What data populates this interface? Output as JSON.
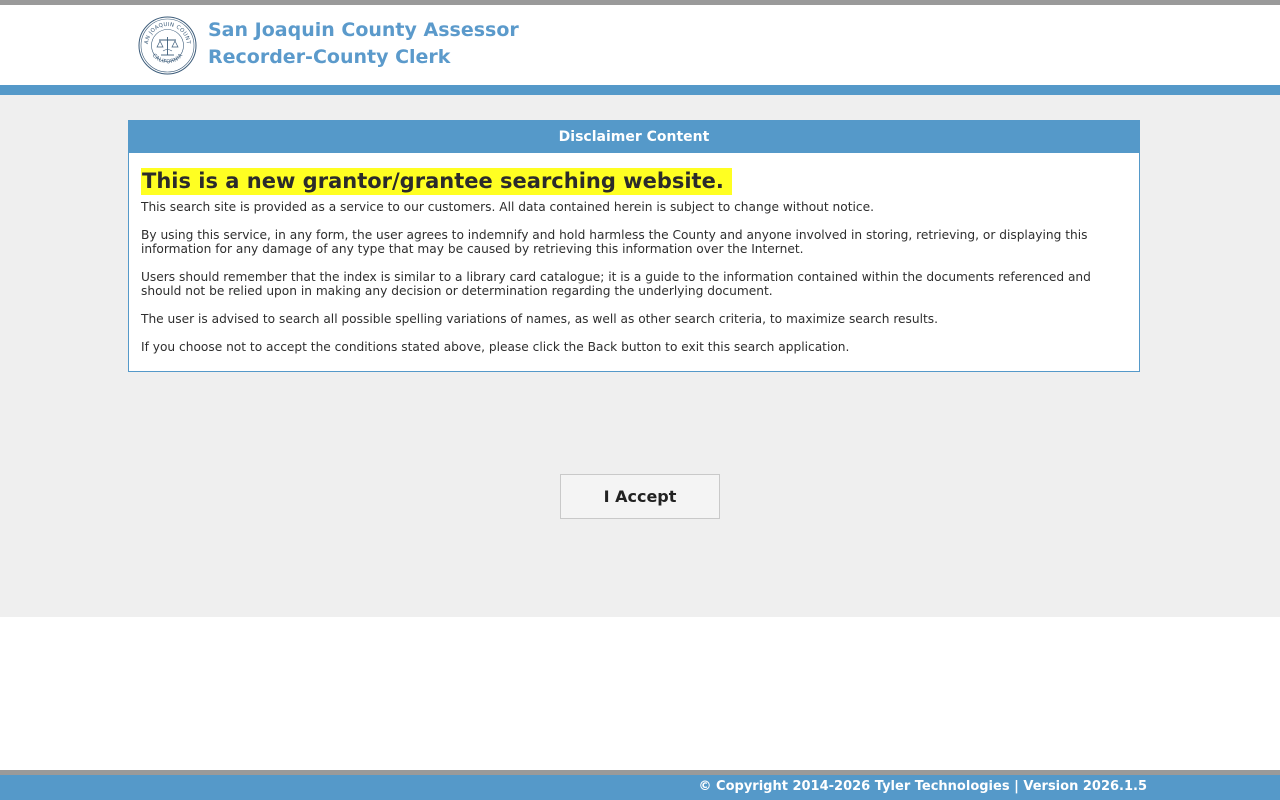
{
  "header": {
    "title": "San Joaquin County Assessor Recorder-County Clerk",
    "seal": {
      "top_text": "SAN JOAQUIN COUNTY",
      "bottom_text": "CALIFORNIA"
    }
  },
  "panel": {
    "title": "Disclaimer Content",
    "headline": "This is a new grantor/grantee searching website.",
    "paragraphs": [
      "This search site is provided as a service to our customers. All data contained herein is subject to change without notice.",
      "By using this service, in any form, the user agrees to indemnify and hold harmless the County and anyone involved in storing, retrieving, or displaying this information for any damage of any type that may be caused by retrieving this information over the Internet.",
      "Users should remember that the index is similar to a library card catalogue; it is a guide to the information contained within the documents referenced and should not be relied upon in making any decision or determination regarding the underlying document.",
      "The user is advised to search all possible spelling variations of names, as well as other search criteria, to maximize search results.",
      "If you choose not to accept the conditions stated above, please click the Back button to exit this search application."
    ]
  },
  "actions": {
    "accept_label": "I Accept"
  },
  "footer": {
    "text": "© Copyright 2014-2026 Tyler Technologies | Version 2026.1.5"
  },
  "colors": {
    "accent": "#5599c9",
    "highlight": "#ffff22",
    "title_text": "#5b9acb",
    "background": "#efefef"
  }
}
